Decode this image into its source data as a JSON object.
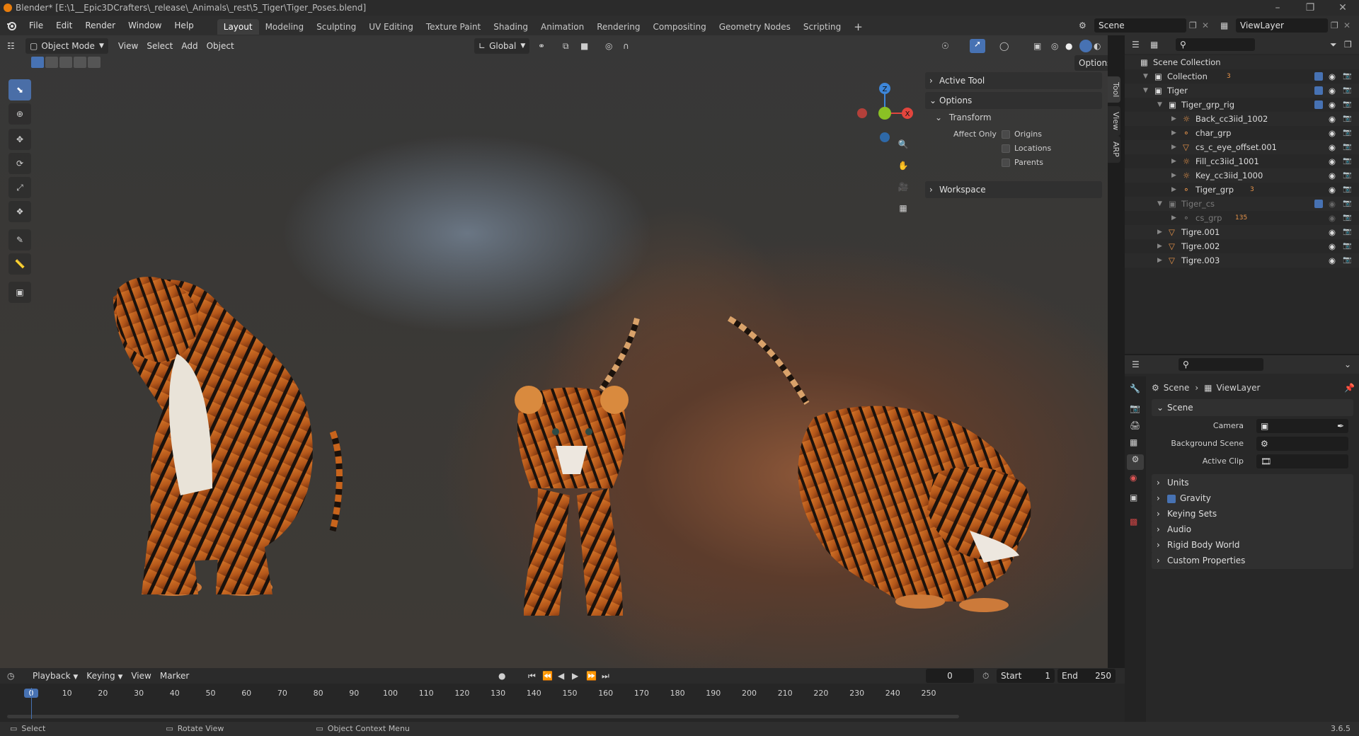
{
  "window": {
    "title": "Blender* [E:\\1__Epic3DCrafters\\_release\\_Animals\\_rest\\5_Tiger\\Tiger_Poses.blend]"
  },
  "menu": {
    "items": [
      "File",
      "Edit",
      "Render",
      "Window",
      "Help"
    ]
  },
  "workspaces": {
    "tabs": [
      "Layout",
      "Modeling",
      "Sculpting",
      "UV Editing",
      "Texture Paint",
      "Shading",
      "Animation",
      "Rendering",
      "Compositing",
      "Geometry Nodes",
      "Scripting"
    ],
    "active": "Layout",
    "add_label": "+"
  },
  "scene_selector": {
    "scene": "Scene",
    "view_layer": "ViewLayer"
  },
  "viewport_header": {
    "mode": "Object Mode",
    "menus": [
      "View",
      "Select",
      "Add",
      "Object"
    ],
    "orientation": "Global",
    "options_label": "Options"
  },
  "npanel": {
    "active_tool": "Active Tool",
    "options": "Options",
    "transform": "Transform",
    "affect_only": "Affect Only",
    "checkboxes": [
      {
        "label": "Origins",
        "checked": false
      },
      {
        "label": "Locations",
        "checked": false
      },
      {
        "label": "Parents",
        "checked": false
      }
    ],
    "workspace": "Workspace",
    "tabs": [
      "Tool",
      "View",
      "ARP"
    ]
  },
  "gizmo": {
    "x": "X",
    "y": "Y",
    "z": "Z"
  },
  "outliner": {
    "rows": [
      {
        "label": "Scene Collection",
        "indent": 0,
        "icon": "scene-collection",
        "dim": false
      },
      {
        "label": "Collection",
        "indent": 1,
        "icon": "collection",
        "dim": false,
        "badge": "3"
      },
      {
        "label": "Tiger",
        "indent": 1,
        "icon": "collection",
        "dim": false
      },
      {
        "label": "Tiger_grp_rig",
        "indent": 2,
        "icon": "collection",
        "dim": false
      },
      {
        "label": "Back_cc3iid_1002",
        "indent": 3,
        "icon": "light",
        "dim": false
      },
      {
        "label": "char_grp",
        "indent": 3,
        "icon": "armature",
        "dim": false
      },
      {
        "label": "cs_c_eye_offset.001",
        "indent": 3,
        "icon": "mesh",
        "dim": false
      },
      {
        "label": "Fill_cc3iid_1001",
        "indent": 3,
        "icon": "light",
        "dim": false
      },
      {
        "label": "Key_cc3iid_1000",
        "indent": 3,
        "icon": "light",
        "dim": false
      },
      {
        "label": "Tiger_grp",
        "indent": 3,
        "icon": "armature",
        "dim": false,
        "badge": "3"
      },
      {
        "label": "Tiger_cs",
        "indent": 2,
        "icon": "collection",
        "dim": true
      },
      {
        "label": "cs_grp",
        "indent": 3,
        "icon": "armature",
        "dim": true,
        "badge": "135"
      },
      {
        "label": "Tigre.001",
        "indent": 2,
        "icon": "mesh",
        "dim": false
      },
      {
        "label": "Tigre.002",
        "indent": 2,
        "icon": "mesh",
        "dim": false
      },
      {
        "label": "Tigre.003",
        "indent": 2,
        "icon": "mesh",
        "dim": false
      }
    ]
  },
  "properties": {
    "breadcrumb_scene": "Scene",
    "breadcrumb_layer": "ViewLayer",
    "section": "Scene",
    "camera_label": "Camera",
    "background_scene_label": "Background Scene",
    "active_clip_label": "Active Clip",
    "subsections": [
      "Units",
      "Gravity",
      "Keying Sets",
      "Audio",
      "Rigid Body World",
      "Custom Properties"
    ],
    "gravity_checked": true
  },
  "timeline": {
    "menus": [
      "Playback",
      "Keying",
      "View",
      "Marker"
    ],
    "current_frame": "0",
    "start_label": "Start",
    "start": "1",
    "end_label": "End",
    "end": "250",
    "ticks": [
      "0",
      "10",
      "20",
      "30",
      "40",
      "50",
      "60",
      "70",
      "80",
      "90",
      "100",
      "110",
      "120",
      "130",
      "140",
      "150",
      "160",
      "170",
      "180",
      "190",
      "200",
      "210",
      "220",
      "230",
      "240",
      "250"
    ]
  },
  "statusbar": {
    "select": "Select",
    "rotate": "Rotate View",
    "context": "Object Context Menu",
    "version": "3.6.5"
  },
  "colors": {
    "accent": "#4772b3",
    "tiger_orange": "#c8641c",
    "axis_x": "#e2453d",
    "axis_y": "#8ac124",
    "axis_z": "#3d86d9"
  }
}
